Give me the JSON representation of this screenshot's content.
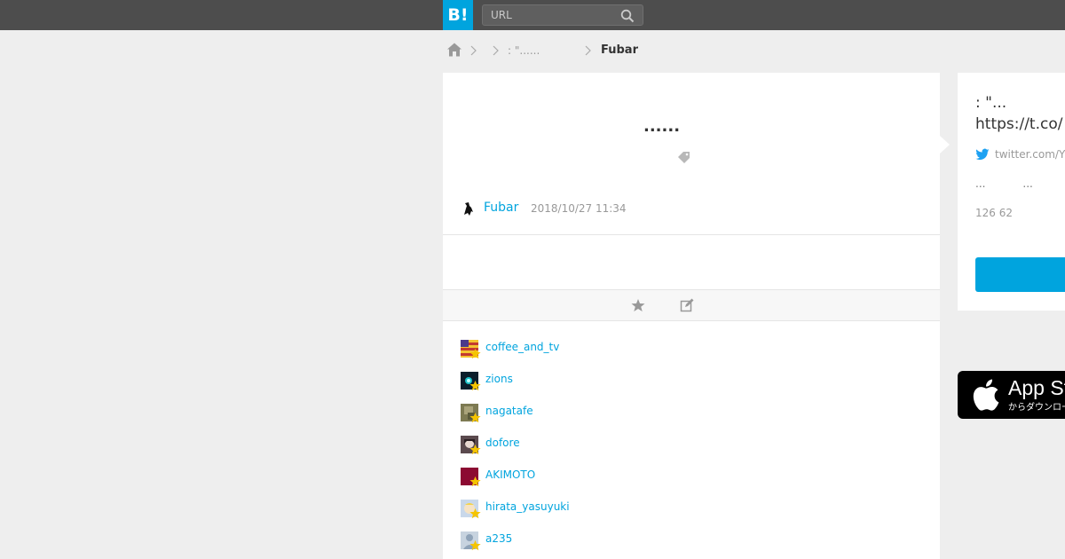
{
  "header": {
    "logo": "B!",
    "search_placeholder": "URL",
    "search_icon": "search-icon"
  },
  "breadcrumb": {
    "home_icon": "home-icon",
    "middle": ": \"......",
    "current": "Fubar"
  },
  "entry": {
    "title": "......",
    "tag_icon": "tag-icon",
    "user": "Fubar",
    "date": "2018/10/27 11:34"
  },
  "actions": {
    "star_icon": "star-icon",
    "edit_icon": "edit-icon"
  },
  "stars": [
    {
      "name": "coffee_and_tv",
      "avatar_color": "#c33a2f"
    },
    {
      "name": "zions",
      "avatar_color": "#0b1e2c"
    },
    {
      "name": "nagatafe",
      "avatar_color": "#7d7a52"
    },
    {
      "name": "dofore",
      "avatar_color": "#5b4a4e"
    },
    {
      "name": "AKIMOTO",
      "avatar_color": "#8c0a32"
    },
    {
      "name": "hirata_yasuyuki",
      "avatar_color": "#c9d8ea"
    },
    {
      "name": "a235",
      "avatar_color": "#a7b7c8"
    }
  ],
  "sidebar": {
    "tweet_line1": ": \"...",
    "tweet_line2": "https://t.co/",
    "source_icon": "twitter-icon",
    "source_domain": "twitter.com/Y",
    "meta_line": "...           ...",
    "counts": "126 62"
  },
  "appstore": {
    "big": "App St",
    "small": "からダウンロー"
  },
  "colors": {
    "brand": "#00a4de",
    "topbar": "#4d4d4d",
    "star": "#f5c400"
  }
}
